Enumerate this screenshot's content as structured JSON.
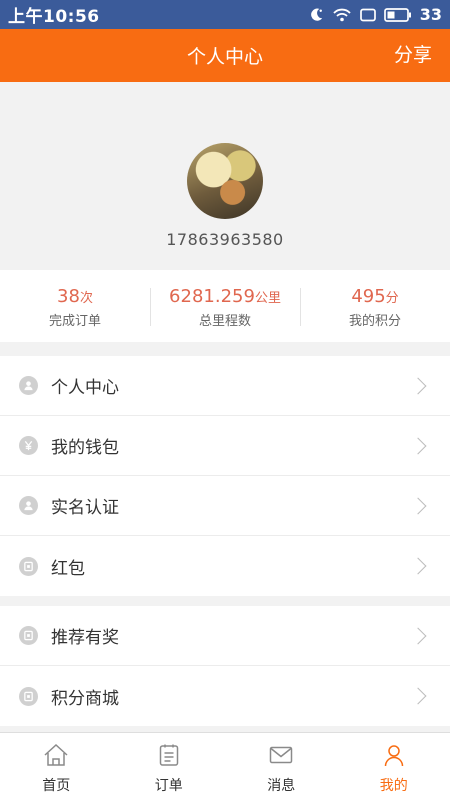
{
  "status_bar": {
    "time": "上午10:56",
    "battery": "33"
  },
  "header": {
    "title": "个人中心",
    "share": "分享"
  },
  "profile": {
    "phone": "17863963580"
  },
  "stats": [
    {
      "value": "38",
      "unit": "次",
      "label": "完成订单"
    },
    {
      "value": "6281.259",
      "unit": "公里",
      "label": "总里程数"
    },
    {
      "value": "495",
      "unit": "分",
      "label": "我的积分"
    }
  ],
  "menu_group1": [
    {
      "label": "个人中心",
      "icon": "person-icon"
    },
    {
      "label": "我的钱包",
      "icon": "yen-icon"
    },
    {
      "label": "实名认证",
      "icon": "person-icon"
    },
    {
      "label": "红包",
      "icon": "card-icon"
    }
  ],
  "menu_group2": [
    {
      "label": "推荐有奖",
      "icon": "card-icon"
    },
    {
      "label": "积分商城",
      "icon": "card-icon"
    }
  ],
  "tabs": [
    {
      "label": "首页",
      "icon": "home-icon"
    },
    {
      "label": "订单",
      "icon": "order-icon"
    },
    {
      "label": "消息",
      "icon": "message-icon"
    },
    {
      "label": "我的",
      "icon": "user-icon"
    }
  ],
  "colors": {
    "accent": "#f86c12",
    "status_bar": "#3b5b9a",
    "stat_value": "#e0674f"
  }
}
